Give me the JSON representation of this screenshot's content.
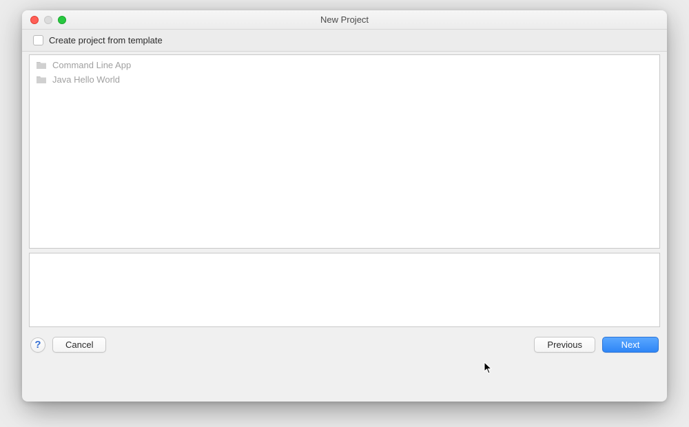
{
  "window": {
    "title": "New Project"
  },
  "checkbox": {
    "label": "Create project from template",
    "checked": false
  },
  "templates": [
    {
      "label": "Command Line App"
    },
    {
      "label": "Java Hello World"
    }
  ],
  "buttons": {
    "help": "?",
    "cancel": "Cancel",
    "previous": "Previous",
    "next": "Next"
  }
}
